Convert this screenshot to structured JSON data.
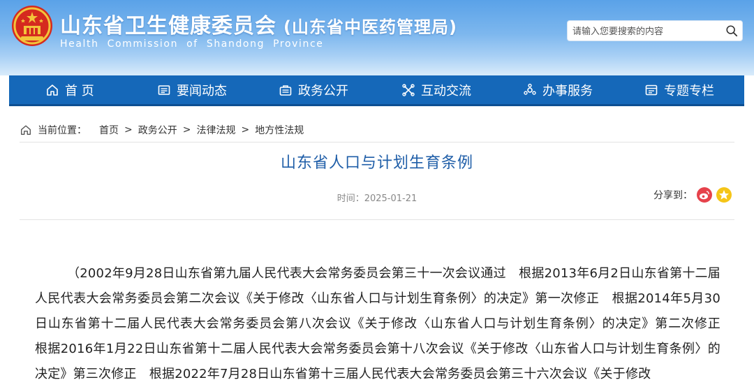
{
  "header": {
    "title": "山东省卫生健康委员会",
    "subtitle": "(山东省中医药管理局)",
    "title_en": "Health Commission of Shandong Province",
    "search_placeholder": "请输入您要搜索的内容",
    "search_icon": "search-icon",
    "emblem_icon": "national-emblem-icon"
  },
  "nav": {
    "items": [
      {
        "label": "首 页",
        "icon": "home-icon"
      },
      {
        "label": "要闻动态",
        "icon": "news-icon"
      },
      {
        "label": "政务公开",
        "icon": "gov-info-icon"
      },
      {
        "label": "互动交流",
        "icon": "interaction-icon"
      },
      {
        "label": "办事服务",
        "icon": "service-icon"
      },
      {
        "label": "专题专栏",
        "icon": "topic-icon"
      }
    ]
  },
  "breadcrumb": {
    "label": "当前位置：",
    "items": [
      "首页",
      "政务公开",
      "法律法规",
      "地方性法规"
    ],
    "separator": ">"
  },
  "article": {
    "title": "山东省人口与计划生育条例",
    "date_label": "时间：",
    "date": "2025-01-21",
    "share_label": "分享到：",
    "body": "（2002年9月28日山东省第九届人民代表大会常务委员会第三十一次会议通过　根据2013年6月2日山东省第十二届人民代表大会常务委员会第二次会议《关于修改〈山东省人口与计划生育条例〉的决定》第一次修正　根据2014年5月30日山东省第十二届人民代表大会常务委员会第八次会议《关于修改〈山东省人口与计划生育条例〉的决定》第二次修正　根据2016年1月22日山东省第十二届人民代表大会常务委员会第十八次会议《关于修改〈山东省人口与计划生育条例〉的决定》第三次修正　根据2022年7月28日山东省第十三届人民代表大会常务委员会第三十六次会议《关于修改"
  },
  "colors": {
    "nav_bg": "#1568b9",
    "title_blue": "#1f5ea8",
    "weibo_red": "#e6424b",
    "qzone_yellow": "#f5c518"
  }
}
